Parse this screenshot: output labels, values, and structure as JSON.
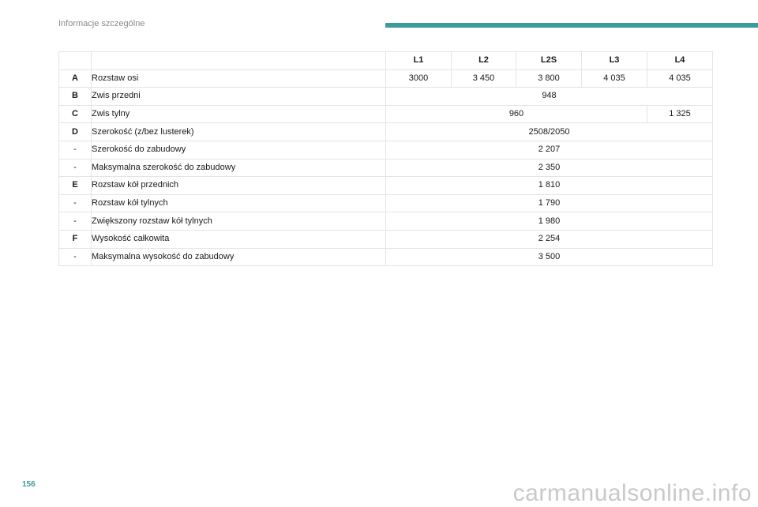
{
  "header": {
    "section_title": "Informacje szczególne",
    "accent_color": "#3a9c9c"
  },
  "table": {
    "columns": [
      "L1",
      "L2",
      "L2S",
      "L3",
      "L4"
    ],
    "rows": [
      {
        "code": "A",
        "label": "Rozstaw osi",
        "values": [
          "3000",
          "3 450",
          "3 800",
          "4 035",
          "4 035"
        ]
      },
      {
        "code": "B",
        "label": "Zwis przedni",
        "values": [
          "948"
        ]
      },
      {
        "code": "C",
        "label": "Zwis tylny",
        "values": [
          "960",
          "1 325"
        ]
      },
      {
        "code": "D",
        "label": "Szerokość (z/bez lusterek)",
        "values": [
          "2508/2050"
        ]
      },
      {
        "code": "-",
        "label": "Szerokość do zabudowy",
        "values": [
          "2 207"
        ]
      },
      {
        "code": "-",
        "label": "Maksymalna szerokość do zabudowy",
        "values": [
          "2 350"
        ]
      },
      {
        "code": "E",
        "label": "Rozstaw kół przednich",
        "values": [
          "1 810"
        ]
      },
      {
        "code": "-",
        "label": "Rozstaw kół tylnych",
        "values": [
          "1 790"
        ]
      },
      {
        "code": "-",
        "label": "Zwiększony rozstaw kół tylnych",
        "values": [
          "1 980"
        ]
      },
      {
        "code": "F",
        "label": "Wysokość całkowita",
        "values": [
          "2 254"
        ]
      },
      {
        "code": "-",
        "label": "Maksymalna wysokość do zabudowy",
        "values": [
          "3 500"
        ]
      }
    ]
  },
  "footer": {
    "page_number": "156",
    "watermark": "carmanualsonline.info"
  }
}
